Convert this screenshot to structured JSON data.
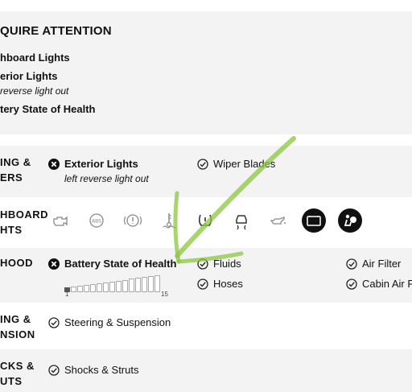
{
  "attention": {
    "title": "QUIRE ATTENTION",
    "items": [
      "hboard Lights",
      "erior Lights",
      "tery State of Health"
    ],
    "note": "reverse light out"
  },
  "rows": {
    "lighting": {
      "cat1": "ING &",
      "cat2": "ERS",
      "bad_label": "Exterior Lights",
      "bad_note": "left reverse light out",
      "ok_label": "Wiper Blades"
    },
    "dashboard": {
      "cat1": "HBOARD",
      "cat2": "HTS",
      "icons": [
        "engine-icon",
        "abs-icon",
        "brake-icon",
        "coolant-temp-icon",
        "tire-pressure-icon",
        "traction-icon",
        "oil-can-icon",
        "battery-icon",
        "airbag-icon"
      ],
      "active_icons": [
        "battery-icon",
        "airbag-icon"
      ]
    },
    "hood": {
      "cat1": "HOOD",
      "bad_label": "Battery State of Health",
      "meter_min": "1",
      "meter_max": "15",
      "meter_level": 1,
      "meter_segments": 15,
      "fluids": "Fluids",
      "hoses": "Hoses",
      "air_filter": "Air Filter",
      "cabin": "Cabin Air F"
    },
    "steering": {
      "cat1": "ING &",
      "cat2": "NSION",
      "ok_label": "Steering & Suspension"
    },
    "shocks": {
      "cat1": "CKS &",
      "cat2": "UTS",
      "ok_label": "Shocks & Struts"
    }
  },
  "colors": {
    "alert": "#111111",
    "ok": "#222222",
    "band": "#f3f3f3",
    "annotation": "#8cc63f"
  }
}
